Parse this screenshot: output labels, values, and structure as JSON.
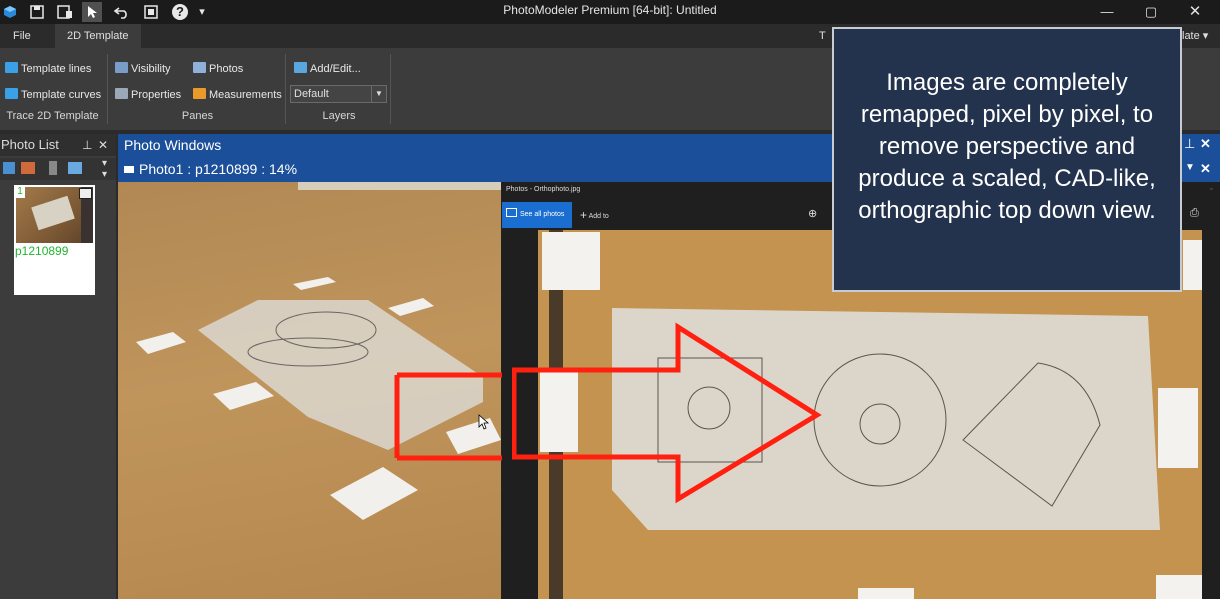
{
  "window": {
    "title": "PhotoModeler Premium [64-bit]: Untitled",
    "minimize": "—",
    "maximize": "▢",
    "close": "✕",
    "quick_help": "?",
    "quick_dropdown": "▾"
  },
  "ribbon": {
    "tabs": [
      "File",
      "2D Template"
    ],
    "partial_right_tab": "T",
    "partial_right_tab2": "late",
    "trace_group": {
      "label": "Trace 2D Template",
      "template_lines": "Template lines",
      "template_curves": "Template curves"
    },
    "panes_group": {
      "label": "Panes",
      "visibility": "Visibility",
      "properties": "Properties",
      "photos": "Photos",
      "measurements": "Measurements"
    },
    "layers_group": {
      "label": "Layers",
      "add_edit": "Add/Edit...",
      "selected_layer": "Default"
    }
  },
  "photo_list": {
    "title": "Photo List",
    "pin": "⊥",
    "close": "✕",
    "thumbnail": {
      "number": "1",
      "name": "p1210899"
    }
  },
  "photo_windows": {
    "title": "Photo Windows",
    "photo_tab": "Photo1 : p1210899 : 14%",
    "pin": "⊥",
    "close": "✕"
  },
  "ortho_viewer": {
    "title": "Photos - Orthophoto.jpg",
    "see_all": "See all photos",
    "add_to": "Add to"
  },
  "callout": {
    "text": "Images are completely remapped, pixel by pixel, to remove perspective and produce a scaled, CAD-like, orthographic top down view."
  },
  "colors": {
    "accent_blue": "#1b4f9a",
    "arrow_red": "#ff2010",
    "callout_bg": "#23324d",
    "thumb_label_green": "#22b530"
  }
}
